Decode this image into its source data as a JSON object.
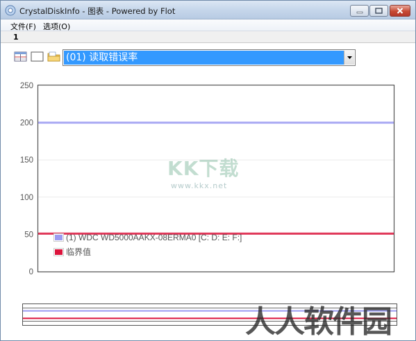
{
  "window": {
    "title": "CrystalDiskInfo - 图表 - Powered by Flot"
  },
  "menu": {
    "file": "文件(F)",
    "options": "选项(O)"
  },
  "tab": {
    "label": "1"
  },
  "toolbar": {
    "icons": [
      "table-icon",
      "window-icon",
      "folder-icon"
    ],
    "select_value": "(01) 读取错误率"
  },
  "colors": {
    "selection": "#3399ff",
    "series_drive": "#9b9bf2",
    "series_threshold": "#dc143c"
  },
  "chart_data": {
    "type": "line",
    "ylim": [
      0,
      250
    ],
    "yticks": [
      0,
      50,
      100,
      150,
      200,
      250
    ],
    "grid": true,
    "legend_position": "bottom-left",
    "series": [
      {
        "name": "(1) WDC WD5000AAKX-08ERMA0 [C: D: E: F:]",
        "color": "#9b9bf2",
        "values": [
          200,
          200
        ]
      },
      {
        "name": "临界值",
        "color": "#dc143c",
        "values": [
          51,
          51
        ]
      }
    ]
  },
  "watermarks": {
    "center_main": "KK下载",
    "center_sub": "www.kkx.net",
    "corner": "人人软件园"
  }
}
